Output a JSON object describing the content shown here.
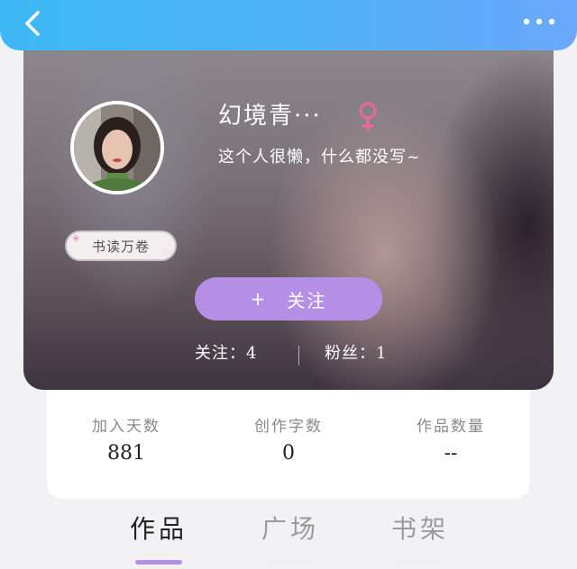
{
  "header": {
    "back_icon": "chevron-left-icon",
    "more_icon": "more-horizontal-icon",
    "colors": {
      "start": "#3db8f5",
      "end": "#6aa8fb"
    }
  },
  "profile": {
    "username": "幻境青···",
    "gender_icon": "female-symbol-icon",
    "gender_color": "#e86a9a",
    "bio": "这个人很懒，什么都没写~",
    "badge": "书读万卷",
    "follow_button": {
      "plus": "+",
      "label": "关注",
      "color": "#b58ee6"
    },
    "following": {
      "label": "关注：",
      "value": "4"
    },
    "fans": {
      "label": "粉丝：",
      "value": "1"
    }
  },
  "info": [
    {
      "label": "加入天数",
      "value": "881"
    },
    {
      "label": "创作字数",
      "value": "0"
    },
    {
      "label": "作品数量",
      "value": "--"
    }
  ],
  "tabs": [
    {
      "label": "作品",
      "active": true,
      "indicator_color": "#b58ee6"
    },
    {
      "label": "广场",
      "active": false,
      "indicator_color": "#eeeeee"
    },
    {
      "label": "书架",
      "active": false,
      "indicator_color": "#eeeeee"
    }
  ]
}
